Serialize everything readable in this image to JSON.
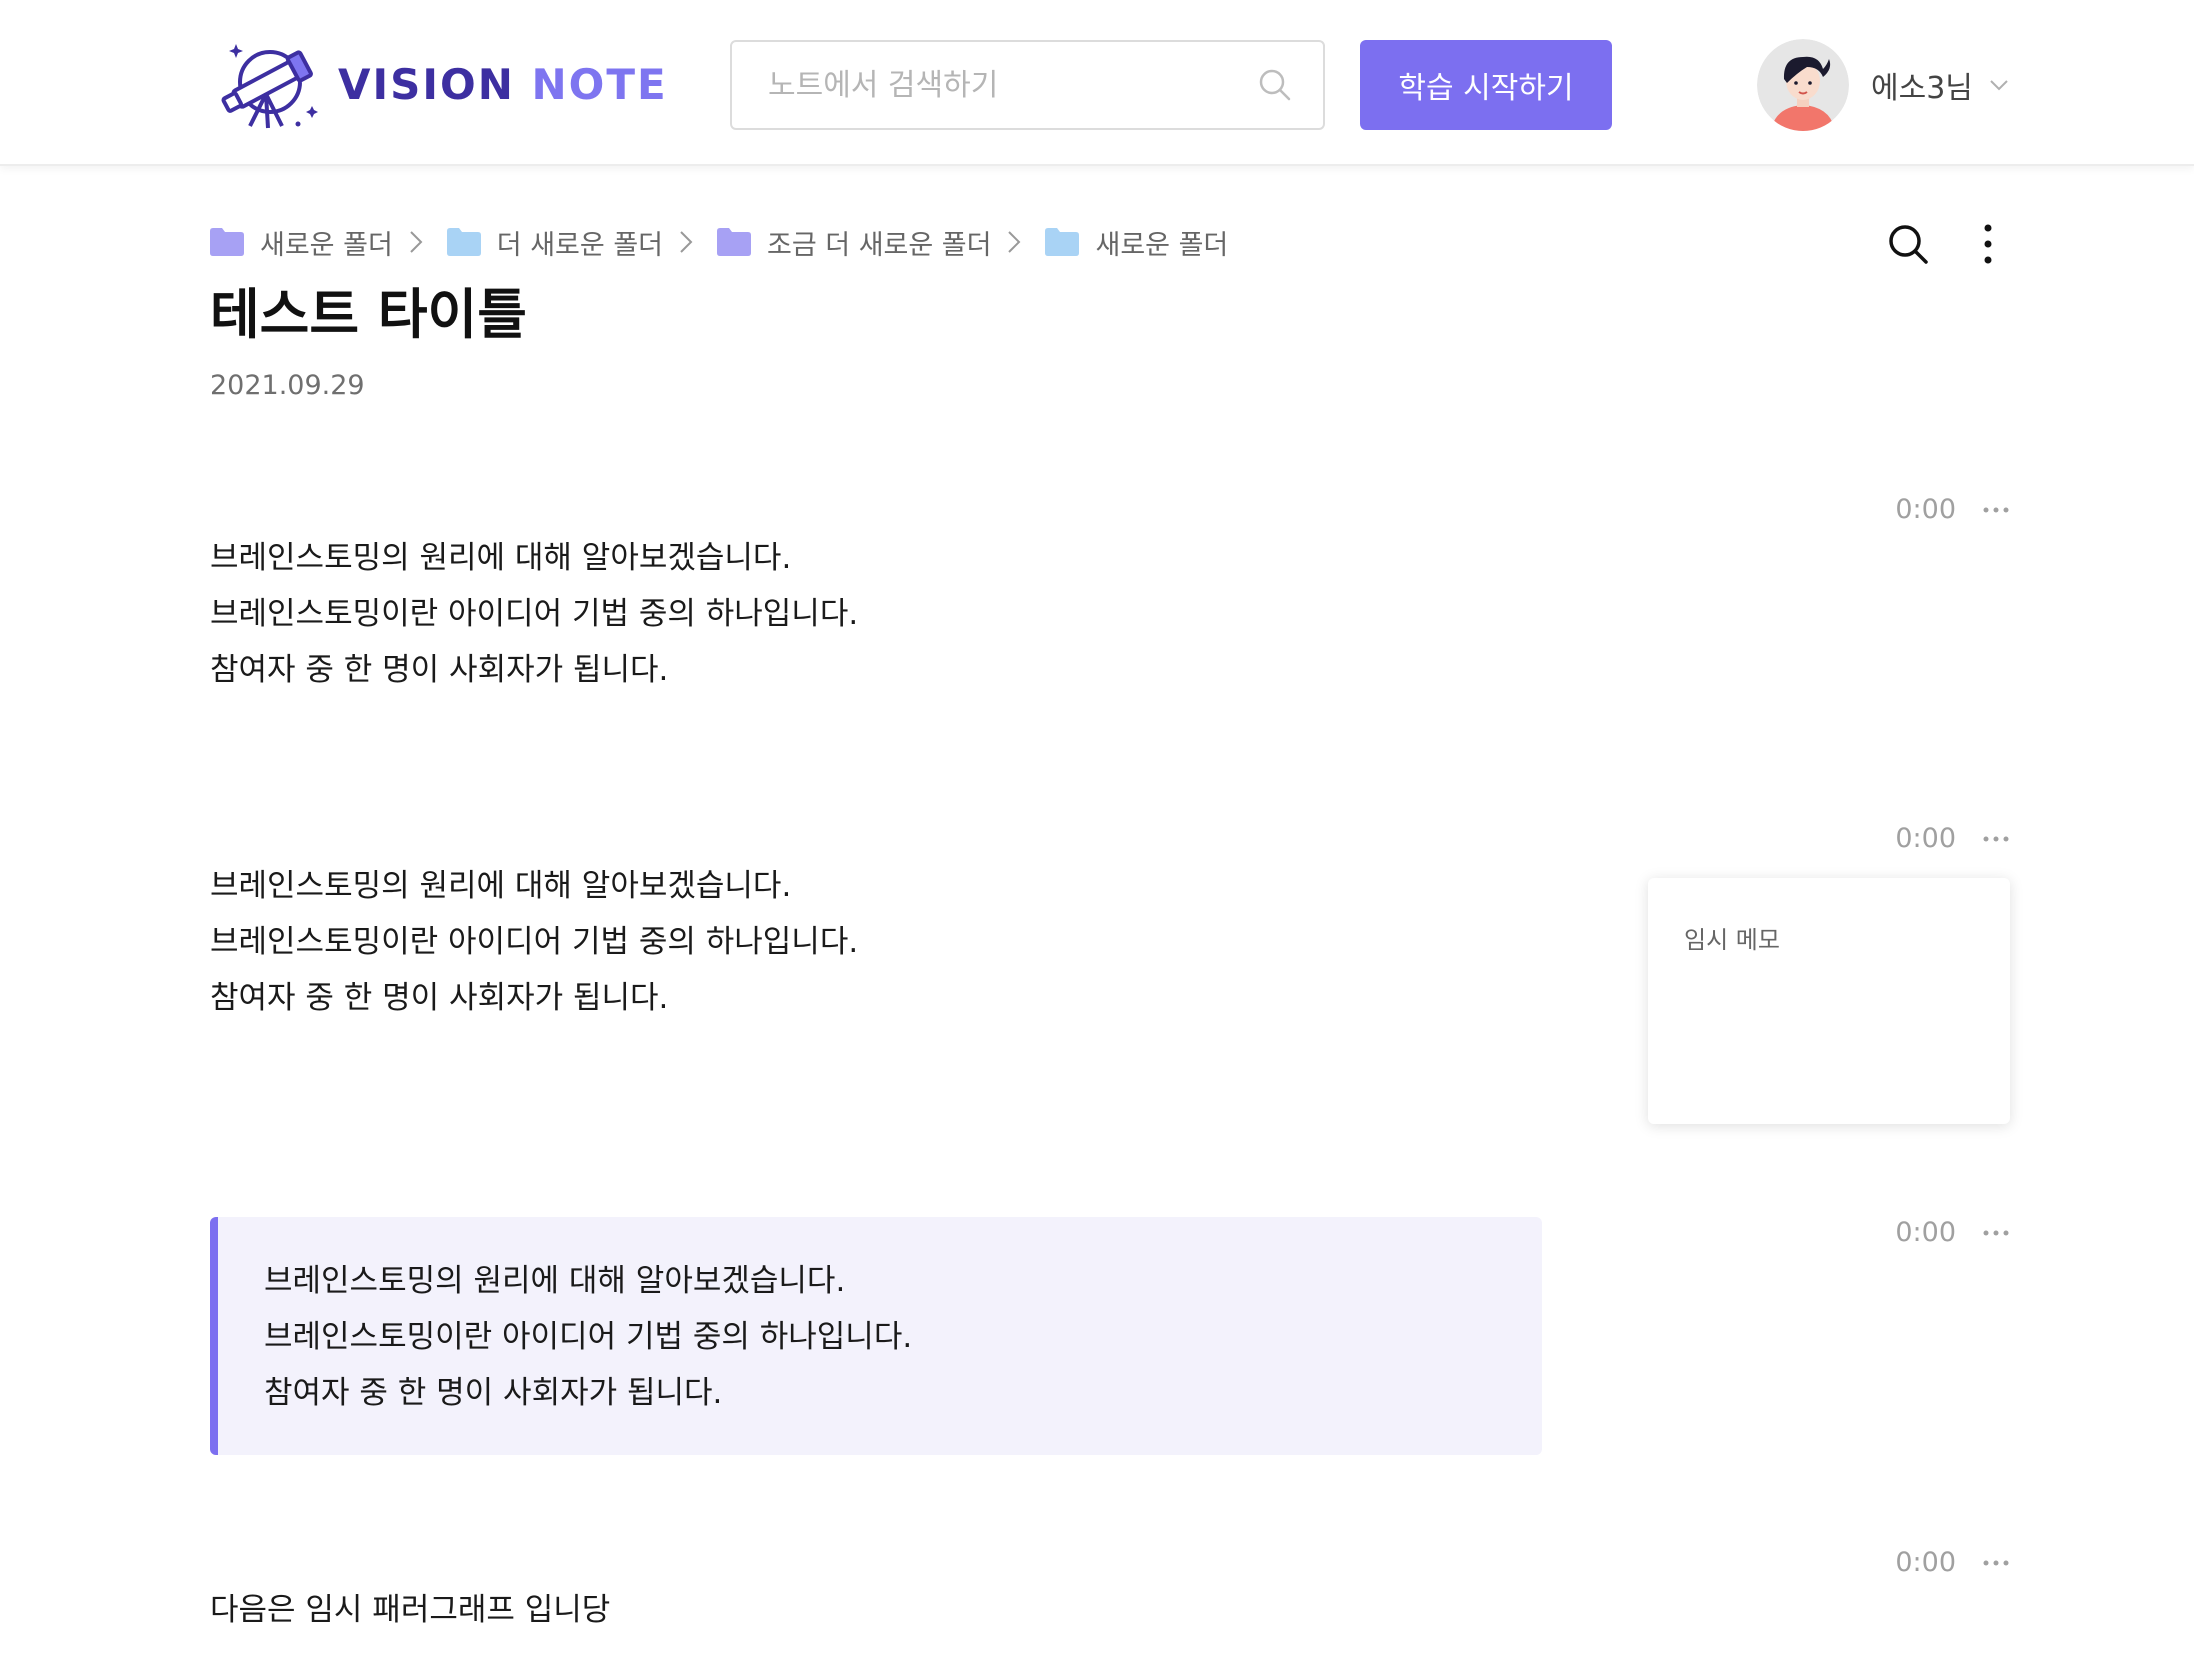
{
  "header": {
    "logo": {
      "word1": "VISION",
      "word2": "NOTE"
    },
    "search": {
      "placeholder": "노트에서 검색하기"
    },
    "start_button": "학습 시작하기",
    "user_name": "에소3님"
  },
  "breadcrumb": [
    {
      "label": "새로운 폴더",
      "color": "#a7a1f4"
    },
    {
      "label": "더 새로운 폴더",
      "color": "#a9d3f5"
    },
    {
      "label": "조금 더 새로운 폴더",
      "color": "#a7a1f4"
    },
    {
      "label": "새로운 폴더",
      "color": "#a9d3f5"
    }
  ],
  "note": {
    "title": "테스트 타이틀",
    "date": "2021.09.29"
  },
  "blocks": [
    {
      "time": "0:00",
      "lines": [
        "브레인스토밍의 원리에 대해 알아보겠습니다.",
        "브레인스토밍이란 아이디어 기법 중의 하나입니다.",
        "참여자 중 한 명이 사회자가 됩니다."
      ]
    },
    {
      "time": "0:00",
      "lines": [
        "브레인스토밍의 원리에 대해 알아보겠습니다.",
        "브레인스토밍이란 아이디어 기법 중의 하나입니다.",
        "참여자 중 한 명이 사회자가 됩니다."
      ],
      "memo": "임시 메모"
    },
    {
      "time": "0:00",
      "lines": [
        "브레인스토밍의 원리에 대해 알아보겠습니다.",
        "브레인스토밍이란 아이디어 기법 중의 하나입니다.",
        "참여자 중 한 명이 사회자가 됩니다."
      ],
      "highlighted": true
    },
    {
      "time": "0:00",
      "lines": [
        "다음은 임시 패러그래프 입니당"
      ]
    }
  ],
  "colors": {
    "accent": "#7c6ff0",
    "logo_dark": "#3d2fa1",
    "highlight_bg": "#f3f2fc"
  }
}
